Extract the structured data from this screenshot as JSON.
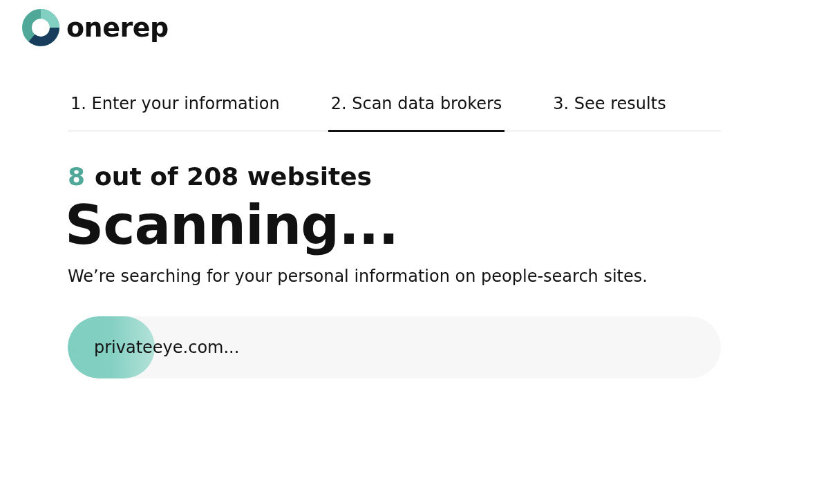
{
  "logo": {
    "wordmark": "onerep"
  },
  "steps": [
    {
      "label": "1. Enter your information",
      "selected": false
    },
    {
      "label": "2. Scan data brokers",
      "selected": true
    },
    {
      "label": "3. See results",
      "selected": false
    }
  ],
  "counter": {
    "count": "8",
    "label": "out of 208 websites"
  },
  "title": "Scanning...",
  "description": "We’re searching for your personal information on people-search sites.",
  "progress": {
    "level": 0.133,
    "current_site": "privateeye.com..."
  }
}
